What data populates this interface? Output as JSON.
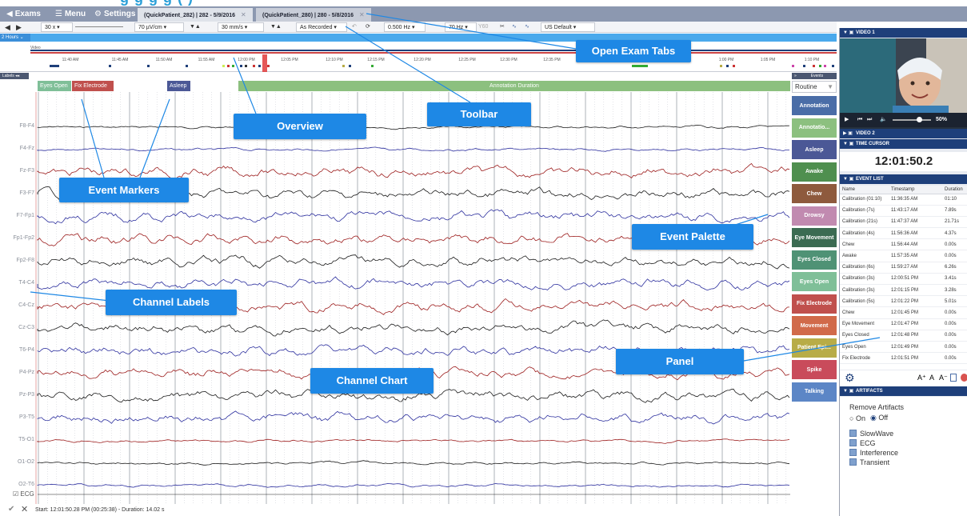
{
  "page_title_peek": "g   g g  g (   )",
  "nav": {
    "exams": "Exams",
    "menu": "Menu",
    "settings": "Settings",
    "tabs": [
      {
        "label": "(QuickPatient_282) | 282 - 5/9/2016"
      },
      {
        "label": "(QuickPatient_280) | 280 - 5/8/2016"
      }
    ],
    "close_glyph": "✕"
  },
  "toolbar": {
    "page_speed": "30 x",
    "sensitivity": "70 µV/cm",
    "timebase": "30 mm/s",
    "montage_mode": "As Recorded",
    "lff": "0.500 Hz",
    "hff": "70 Hz",
    "notch_label": "Y60",
    "profile": "US Default"
  },
  "overview": {
    "range_label": "2 Hours",
    "video_label": "Video",
    "times": [
      "11:40 AM",
      "11:45 AM",
      "11:50 AM",
      "11:55 AM",
      "12:00 PM",
      "12:05 PM",
      "12:10 PM",
      "12:15 PM",
      "12:20 PM",
      "12:25 PM",
      "12:30 PM",
      "12:35 PM",
      "1:00 PM",
      "1:05 PM",
      "1:10 PM"
    ]
  },
  "labels_button": "Labels ◂◂",
  "annotations": [
    {
      "label": "Eyes Open",
      "color": "#7fbf98"
    },
    {
      "label": "Fix Electrode",
      "color": "#c0504d"
    },
    {
      "label": "Asleep",
      "color": "#4b5896"
    },
    {
      "label": "Annotation Duration",
      "color": "#8cc07f"
    }
  ],
  "channels": [
    "F8-F4",
    "F4-Fz",
    "Fz-F3",
    "F3-F7",
    "F7-Fp1",
    "Fp1-Fp2",
    "Fp2-F8",
    "T4-C4",
    "C4-Cz",
    "Cz-C3",
    "T6-P4",
    "P4-Pz",
    "Pz-P3",
    "P3-T5",
    "T5-O1",
    "O1-O2",
    "O2-T6"
  ],
  "channel_colors": {
    "black": "#1a1a1a",
    "blue": "#2c2f9e",
    "red": "#9c1c1c"
  },
  "ecg_label": "ECG",
  "palette": {
    "header": "Events",
    "header_caret": "»",
    "set": "Routine",
    "buttons": [
      {
        "label": "Annotation",
        "color": "#4a6da7"
      },
      {
        "label": "Annotatio...",
        "color": "#8cc07f"
      },
      {
        "label": "Asleep",
        "color": "#4b5896"
      },
      {
        "label": "Awake",
        "color": "#4f8f4f"
      },
      {
        "label": "Chew",
        "color": "#8e5a3d"
      },
      {
        "label": "Drowsy",
        "color": "#c18ab0"
      },
      {
        "label": "Eye Movement",
        "color": "#3b6b52"
      },
      {
        "label": "Eyes Closed",
        "color": "#4f9275"
      },
      {
        "label": "Eyes Open",
        "color": "#7fbf98"
      },
      {
        "label": "Fix Electrode",
        "color": "#c0504d"
      },
      {
        "label": "Movement",
        "color": "#d16a4a"
      },
      {
        "label": "Patient Epi...",
        "color": "#b8ac47"
      },
      {
        "label": "Spike",
        "color": "#c94b5b"
      },
      {
        "label": "Talking",
        "color": "#5c86c6"
      }
    ]
  },
  "status": {
    "text": "Start: 12:01:50.28 PM (00:25:38) - Duration: 14.02 s"
  },
  "panel": {
    "video1": "VIDEO 1",
    "video2": "VIDEO 2",
    "volume": "50%",
    "time_cursor": "TIME CURSOR",
    "time_value": "12:01:50.2",
    "event_list": "EVENT LIST",
    "columns": [
      "Name",
      "Timestamp",
      "Duration"
    ],
    "events": [
      {
        "name": "Calibration (01:10)",
        "time": "11:36:35 AM",
        "dur": "01:10"
      },
      {
        "name": "Calibration (7s)",
        "time": "11:43:17 AM",
        "dur": "7.89s"
      },
      {
        "name": "Calibration (21s)",
        "time": "11:47:37 AM",
        "dur": "21.71s"
      },
      {
        "name": "Calibration (4s)",
        "time": "11:56:36 AM",
        "dur": "4.37s"
      },
      {
        "name": "Chew",
        "time": "11:56:44 AM",
        "dur": "0.00s"
      },
      {
        "name": "Awake",
        "time": "11:57:35 AM",
        "dur": "0.00s"
      },
      {
        "name": "Calibration (6s)",
        "time": "11:59:27 AM",
        "dur": "6.26s"
      },
      {
        "name": "Calibration (3s)",
        "time": "12:00:51 PM",
        "dur": "3.41s"
      },
      {
        "name": "Calibration (3s)",
        "time": "12:01:15 PM",
        "dur": "3.28s"
      },
      {
        "name": "Calibration (5s)",
        "time": "12:01:22 PM",
        "dur": "5.01s"
      },
      {
        "name": "Chew",
        "time": "12:01:45 PM",
        "dur": "0.00s"
      },
      {
        "name": "Eye Movement",
        "time": "12:01:47 PM",
        "dur": "0.00s"
      },
      {
        "name": "Eyes Closed",
        "time": "12:01:48 PM",
        "dur": "0.00s"
      },
      {
        "name": "Eyes Open",
        "time": "12:01:49 PM",
        "dur": "0.00s"
      },
      {
        "name": "Fix Electrode",
        "time": "12:01:51 PM",
        "dur": "0.00s"
      }
    ],
    "font_controls": [
      "A⁺",
      "A",
      "A⁻"
    ],
    "artifacts": "ARTIFACTS",
    "remove_artifacts": "Remove Artifacts",
    "on": "On",
    "off": "Off",
    "artifact_types": [
      "SlowWave",
      "ECG",
      "Interference",
      "Transient"
    ]
  },
  "callouts": {
    "open_exam_tabs": "Open Exam Tabs",
    "toolbar": "Toolbar",
    "overview": "Overview",
    "event_markers": "Event Markers",
    "event_palette": "Event Palette",
    "channel_labels": "Channel Labels",
    "panel": "Panel",
    "channel_chart": "Channel Chart"
  },
  "colors": {
    "accent": "#1e88e5",
    "nav": "#8c98b0",
    "panel_header": "#1e3f7a",
    "cursor": "#e03a3a"
  }
}
